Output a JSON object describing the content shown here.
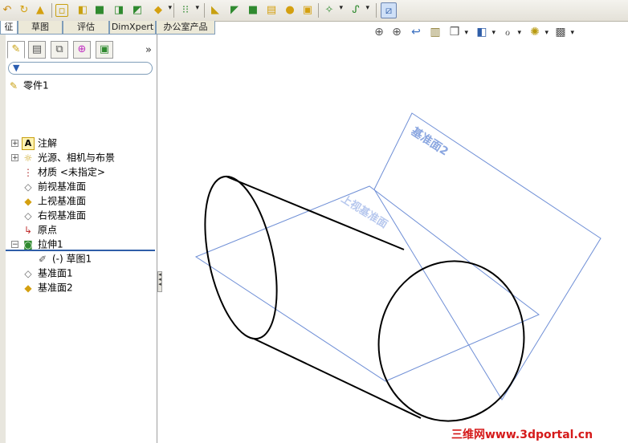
{
  "command_tabs": [
    {
      "label": "征"
    },
    {
      "label": "草图"
    },
    {
      "label": "评估"
    },
    {
      "label": "DimXpert"
    },
    {
      "label": "办公室产品"
    }
  ],
  "feature_tree": {
    "part_name": "零件1",
    "items": [
      {
        "label": "注解",
        "icon": "annotations-icon",
        "expandable": true
      },
      {
        "label": "光源、相机与布景",
        "icon": "lights-cameras-icon",
        "expandable": true
      },
      {
        "label": "材质 <未指定>",
        "icon": "material-icon",
        "expandable": false
      },
      {
        "label": "前视基准面",
        "icon": "plane-icon",
        "expandable": false
      },
      {
        "label": "上视基准面",
        "icon": "plane-icon",
        "expandable": false
      },
      {
        "label": "右视基准面",
        "icon": "plane-icon",
        "expandable": false
      },
      {
        "label": "原点",
        "icon": "origin-icon",
        "expandable": false
      },
      {
        "label": "拉伸1",
        "icon": "extrude-icon",
        "expandable": true,
        "expanded": true
      },
      {
        "label": "(-) 草图1",
        "icon": "sketch-icon",
        "expandable": false,
        "child": true
      },
      {
        "label": "基准面1",
        "icon": "plane-icon",
        "expandable": false
      },
      {
        "label": "基准面2",
        "icon": "plane-icon",
        "expandable": false
      }
    ]
  },
  "viewport": {
    "plane_label_top": "上视基准面",
    "plane_label_2": "基准面2"
  },
  "watermark": "三维网www.3dportal.cn",
  "colors": {
    "plane_edge": "#6f8fd6",
    "plane_label": "#8aa6e0",
    "accent": "#2f5ea8",
    "watermark": "#d51a1a"
  }
}
